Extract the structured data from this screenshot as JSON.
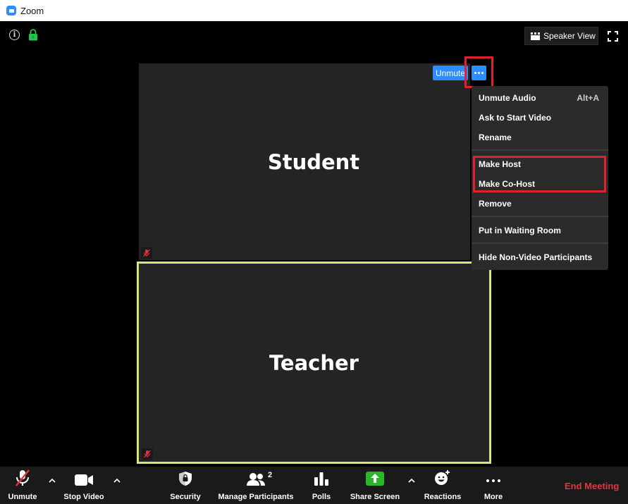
{
  "window": {
    "title": "Zoom"
  },
  "top_bar": {
    "speaker_view_label": "Speaker View"
  },
  "tiles": {
    "student": {
      "name": "Student",
      "unmute_label": "Unmute"
    },
    "teacher": {
      "name": "Teacher"
    }
  },
  "menu": {
    "items": [
      {
        "label": "Unmute Audio",
        "shortcut": "Alt+A"
      },
      {
        "label": "Ask to Start Video"
      },
      {
        "label": "Rename"
      },
      {
        "label": "Make Host"
      },
      {
        "label": "Make Co-Host"
      },
      {
        "label": "Remove"
      },
      {
        "label": "Put in Waiting Room"
      },
      {
        "label": "Hide Non-Video Participants"
      }
    ]
  },
  "toolbar": {
    "unmute": "Unmute",
    "stop_video": "Stop Video",
    "security": "Security",
    "manage_participants": "Manage Participants",
    "participant_count": "2",
    "polls": "Polls",
    "share_screen": "Share Screen",
    "reactions": "Reactions",
    "more": "More",
    "end_meeting": "End Meeting"
  },
  "colors": {
    "accent": "#2d8cff",
    "highlight": "#e0202e",
    "share_green": "#2bb52b",
    "end_red": "#e8333f",
    "active_speaker": "#d4e87a"
  }
}
